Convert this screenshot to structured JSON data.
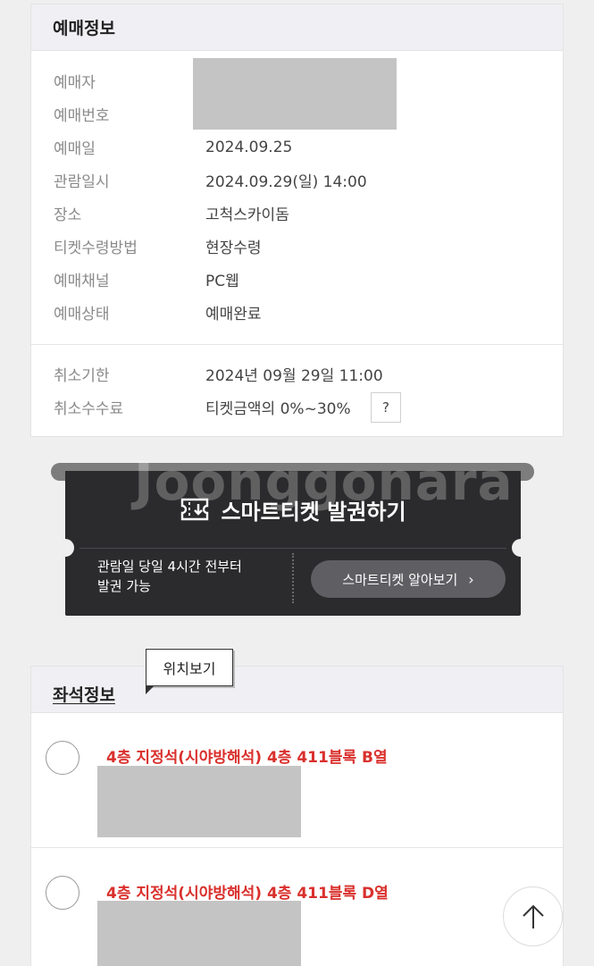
{
  "booking": {
    "title": "예매정보",
    "rows": [
      {
        "key": "예매자",
        "value": ""
      },
      {
        "key": "예매번호",
        "value": ""
      },
      {
        "key": "예매일",
        "value": "2024.09.25"
      },
      {
        "key": "관람일시",
        "value": "2024.09.29(일) 14:00"
      },
      {
        "key": "장소",
        "value": "고척스카이돔"
      },
      {
        "key": "티켓수령방법",
        "value": "현장수령"
      },
      {
        "key": "예매채널",
        "value": "PC웹"
      },
      {
        "key": "예매상태",
        "value": "예매완료"
      }
    ],
    "cancel_rows": [
      {
        "key": "취소기한",
        "value": "2024년 09월 29일 11:00"
      },
      {
        "key": "취소수수료",
        "value": "티켓금액의 0%~30%"
      }
    ],
    "help_label": "?"
  },
  "ticket": {
    "title": "스마트티켓 발권하기",
    "note_line1": "관람일 당일 4시간 전부터",
    "note_line2": "발권 가능",
    "button_label": "스마트티켓 알아보기",
    "button_icon": "chevron-right-icon",
    "icon": "ticket-icon"
  },
  "seats": {
    "title": "좌석정보",
    "location_button": "위치보기",
    "items": [
      {
        "name": "4층 지정석(시야방해석) 4층 411블록 B열"
      },
      {
        "name": "4층 지정석(시야방해석) 4층 411블록 D열"
      }
    ]
  },
  "watermark": "Joonggonara",
  "colors": {
    "accent_red": "#d9302c",
    "ticket_bg": "#2b2b2d"
  }
}
